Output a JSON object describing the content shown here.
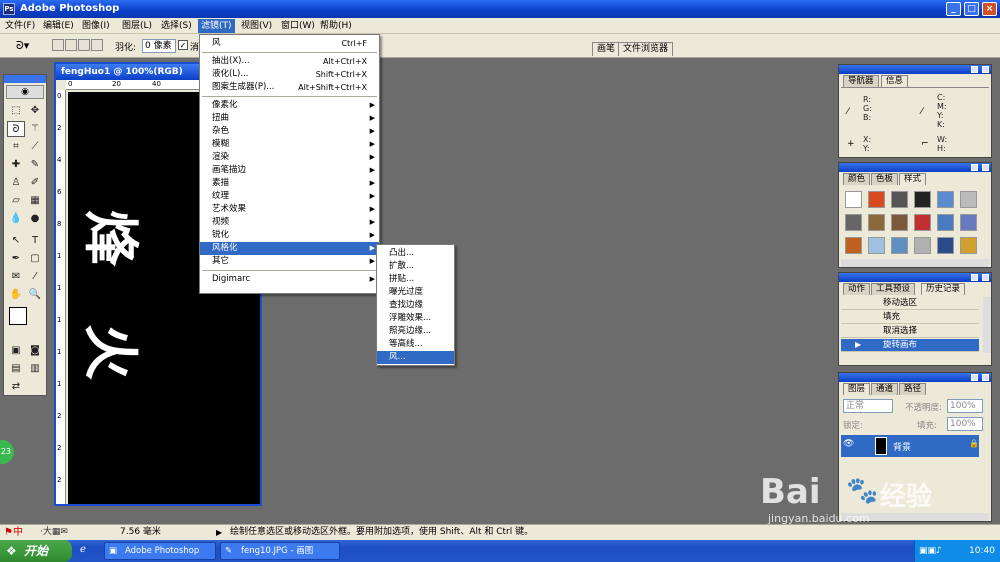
{
  "window": {
    "title": "Adobe Photoshop",
    "icon_label": "Ps"
  },
  "menubar": {
    "items": [
      "文件(F)",
      "编辑(E)",
      "图像(I)",
      "图层(L)",
      "选择(S)",
      "滤镜(T)",
      "视图(V)",
      "窗口(W)",
      "帮助(H)"
    ],
    "active_index": 5
  },
  "options": {
    "feather_label": "羽化:",
    "feather_value": "0 像素",
    "antialias_label": "消",
    "well_tabs": [
      "画笔",
      "文件浏览器"
    ]
  },
  "document": {
    "title": "fengHuo1 @ 100%(RGB)",
    "ruler_top": [
      "0",
      "20",
      "40"
    ],
    "ruler_left": [
      "0",
      "2",
      "4",
      "6",
      "8",
      "1",
      "1",
      "1",
      "1",
      "1",
      "2",
      "2",
      "2"
    ],
    "text": [
      "烽",
      "火"
    ]
  },
  "filter_menu": {
    "items": [
      {
        "label": "风",
        "shortcut": "Ctrl+F"
      },
      {
        "sep": true
      },
      {
        "label": "抽出(X)...",
        "shortcut": "Alt+Ctrl+X"
      },
      {
        "label": "液化(L)...",
        "shortcut": "Shift+Ctrl+X"
      },
      {
        "label": "图案生成器(P)...",
        "shortcut": "Alt+Shift+Ctrl+X"
      },
      {
        "sep": true
      },
      {
        "label": "像素化",
        "sub": true
      },
      {
        "label": "扭曲",
        "sub": true
      },
      {
        "label": "杂色",
        "sub": true
      },
      {
        "label": "模糊",
        "sub": true
      },
      {
        "label": "渲染",
        "sub": true
      },
      {
        "label": "画笔描边",
        "sub": true
      },
      {
        "label": "素描",
        "sub": true
      },
      {
        "label": "纹理",
        "sub": true
      },
      {
        "label": "艺术效果",
        "sub": true
      },
      {
        "label": "视频",
        "sub": true
      },
      {
        "label": "锐化",
        "sub": true
      },
      {
        "label": "风格化",
        "sub": true,
        "highlighted": true
      },
      {
        "label": "其它",
        "sub": true
      },
      {
        "sep": true
      },
      {
        "label": "Digimarc",
        "sub": true
      }
    ]
  },
  "stylize_submenu": {
    "items": [
      "凸出...",
      "扩散...",
      "拼贴...",
      "曝光过度",
      "查找边缘",
      "浮雕效果...",
      "照亮边缘...",
      "等高线...",
      "风..."
    ],
    "highlighted_index": 8
  },
  "panels": {
    "navigator": {
      "tabs": [
        "导航器",
        "信息"
      ],
      "rgb": "R:\nG:\nB:",
      "cmyk": "C:\nM:\nY:\nK:",
      "xy": "X:\nY:",
      "wh": "W:\nH:"
    },
    "color": {
      "tabs": [
        "颜色",
        "色板",
        "样式"
      ]
    },
    "history": {
      "tabs": [
        "动作",
        "工具预设",
        "历史记录"
      ],
      "items": [
        "移动选区",
        "填充",
        "取消选择",
        "旋转画布"
      ],
      "selected_index": 3
    },
    "layers": {
      "tabs": [
        "图层",
        "通道",
        "路径"
      ],
      "blend_mode": "正常",
      "opacity_label": "不透明度:",
      "opacity_value": "100%",
      "lock_label": "锁定:",
      "fill_label": "填充:",
      "fill_value": "100%",
      "layer_name": "背景"
    }
  },
  "status": {
    "ime": "中",
    "zoom": "7.56 毫米",
    "hint": "绘制任意选区或移动选区外框。要用附加选项，使用 Shift、Alt 和 Ctrl 键。"
  },
  "badge": {
    "value": "23"
  },
  "watermark": {
    "brand": "Bai",
    "brand_cn": "经验",
    "url": "jingyan.baidu.com"
  },
  "taskbar": {
    "start": "开始",
    "items": [
      "Adobe Photoshop",
      "feng10.JPG - 画图"
    ],
    "clock": "10:40"
  },
  "colors": {
    "accent": "#316ac5",
    "desktop": "#6c6c6c"
  }
}
